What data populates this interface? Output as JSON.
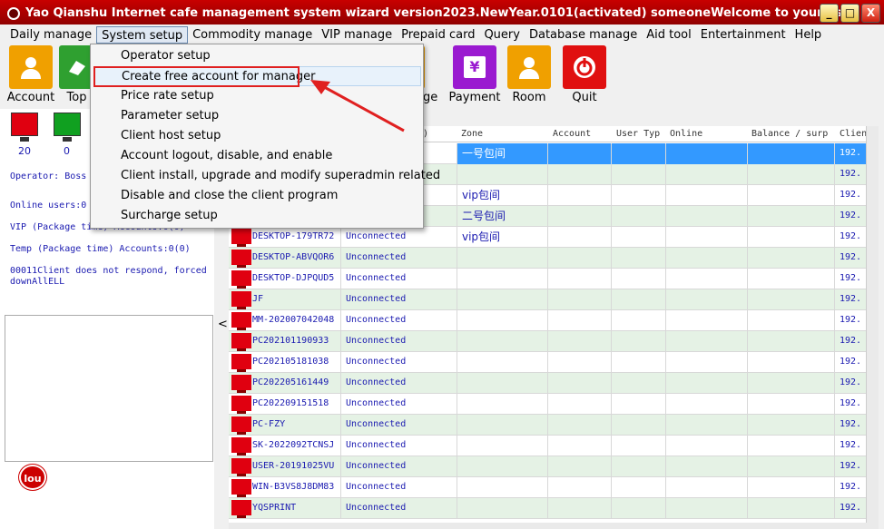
{
  "window": {
    "title": "Yao Qianshu Internet cafe management system wizard version2023.NewYear.0101(activated)  someoneWelcome to your use",
    "btn_min": "_",
    "btn_max": "□",
    "btn_close": "X"
  },
  "menu": [
    "Daily manage",
    "System setup",
    "Commodity manage",
    "VIP manage",
    "Prepaid card",
    "Query",
    "Database manage",
    "Aid tool",
    "Entertainment",
    "Help"
  ],
  "toolbar": {
    "account": "Account",
    "top": "Top",
    "age": "age",
    "payment": "Payment",
    "room": "Room",
    "quit": "Quit",
    "payment_glyph": "¥"
  },
  "status": {
    "mon_red": "20",
    "mon_green": "0",
    "operator": "Operator: Boss",
    "online": "Online users:0",
    "vip": "VIP (Package time) Accounts:0(0)",
    "temp": "Temp (Package time) Accounts:0(0)",
    "msg1": "00011Client does not respond, forced",
    "msg2": "downAllELL",
    "logo": "lou",
    "collapse": "<"
  },
  "dropdown": [
    "Operator setup",
    "Create free account for manager",
    "Price rate setup",
    "Parameter setup",
    "Client host setup",
    "Account logout, disable, and enable",
    "Client install, upgrade and modify superadmin related",
    "Disable and close the client program",
    "Surcharge setup"
  ],
  "grid": {
    "headers": [
      "me)",
      "Zone",
      "Account",
      "User Typ",
      "Online",
      "Balance / surp",
      "Clien"
    ],
    "rows": [
      {
        "name": "",
        "status": "",
        "zone": "一号包间",
        "client": "192."
      },
      {
        "name": "",
        "status": "",
        "zone": "",
        "client": "192."
      },
      {
        "name": "",
        "status": "",
        "zone": "vip包间",
        "client": "192."
      },
      {
        "name": "",
        "status": "",
        "zone": "二号包间",
        "client": "192."
      },
      {
        "name": "DESKTOP-179TR72",
        "status": "Unconnected",
        "zone": "vip包间",
        "client": "192."
      },
      {
        "name": "DESKTOP-ABVQOR6",
        "status": "Unconnected",
        "zone": "",
        "client": "192."
      },
      {
        "name": "DESKTOP-DJPQUD5",
        "status": "Unconnected",
        "zone": "",
        "client": "192."
      },
      {
        "name": "JF",
        "status": "Unconnected",
        "zone": "",
        "client": "192."
      },
      {
        "name": "MM-202007042048",
        "status": "Unconnected",
        "zone": "",
        "client": "192."
      },
      {
        "name": "PC202101190933",
        "status": "Unconnected",
        "zone": "",
        "client": "192."
      },
      {
        "name": "PC202105181038",
        "status": "Unconnected",
        "zone": "",
        "client": "192."
      },
      {
        "name": "PC202205161449",
        "status": "Unconnected",
        "zone": "",
        "client": "192."
      },
      {
        "name": "PC202209151518",
        "status": "Unconnected",
        "zone": "",
        "client": "192."
      },
      {
        "name": "PC-FZY",
        "status": "Unconnected",
        "zone": "",
        "client": "192."
      },
      {
        "name": "SK-2022092TCNSJ",
        "status": "Unconnected",
        "zone": "",
        "client": "192."
      },
      {
        "name": "USER-20191025VU",
        "status": "Unconnected",
        "zone": "",
        "client": "192."
      },
      {
        "name": "WIN-B3VS8J8DM83",
        "status": "Unconnected",
        "zone": "",
        "client": "192."
      },
      {
        "name": "YQSPRINT",
        "status": "Unconnected",
        "zone": "",
        "client": "192."
      }
    ]
  },
  "colors": {
    "title_red": "#c80000",
    "highlight": "#e02020",
    "selection": "#3399ff",
    "row_alt": "#e5f2e5"
  }
}
